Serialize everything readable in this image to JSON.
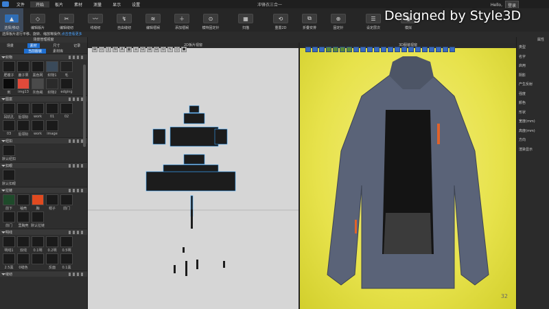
{
  "menubar": {
    "items": [
      "文件",
      "开始",
      "板片",
      "素材",
      "测量",
      "显示",
      "设置"
    ],
    "title": "冲锋衣三合一",
    "user": "Hello,",
    "login": "登录"
  },
  "brand": "Designed by Style3D",
  "toolbar": [
    {
      "label": "选择/移动",
      "icon": "▲"
    },
    {
      "label": "编辑版片",
      "icon": "◇"
    },
    {
      "label": "编辑缝纫",
      "icon": "✂"
    },
    {
      "label": "线缝纫",
      "icon": "〰"
    },
    {
      "label": "自由缝纫",
      "icon": "↯"
    },
    {
      "label": "编辑褶裥",
      "icon": "≋"
    },
    {
      "label": "添加褶裥",
      "icon": "＋"
    },
    {
      "label": "模特固定针",
      "icon": "⊙"
    },
    {
      "label": "扫描",
      "icon": "▦"
    },
    {
      "label": "重置2D",
      "icon": "⟲"
    },
    {
      "label": "折叠安排",
      "icon": "⧉"
    },
    {
      "label": "固定针",
      "icon": "⊕"
    },
    {
      "label": "设定层次",
      "icon": "☰"
    },
    {
      "label": "模拟",
      "icon": "◉"
    }
  ],
  "hint": {
    "text": "选择板片进行平移、旋转、缩放等操作",
    "link": "点击查看更多"
  },
  "left": {
    "title": "场景管理视窗",
    "tabs": [
      "场景",
      "素材",
      "尺寸",
      "记录"
    ],
    "subtabs": [
      "当前服装",
      "素材库"
    ],
    "sections": [
      {
        "name": "织物",
        "items": [
          "肥瘦子",
          "鹿子果",
          "黑色网",
          "织物1",
          "毛",
          "刺",
          "img13",
          "灰色绳",
          "织物2",
          "edging"
        ]
      },
      {
        "name": "图案",
        "items": [
          "耳机孔",
          "后领标",
          "work",
          "01",
          "02",
          "03",
          "后领标",
          "work",
          "image"
        ]
      },
      {
        "name": "纽扣",
        "items": [
          "默认纽扣"
        ]
      },
      {
        "name": "扣眼",
        "items": [
          "默认扣眼"
        ]
      },
      {
        "name": "拉链",
        "items": [
          "前下",
          "袖壳",
          "胸",
          "帽子",
          "前门",
          "前门",
          "里胸壳",
          "默认拉链"
        ]
      },
      {
        "name": "明线",
        "items": [
          "明线1",
          "双线",
          "0.1明",
          "0.2明",
          "0.5明",
          "2.5黑",
          "0缝色",
          "",
          "反面",
          "0.1黑"
        ]
      },
      {
        "name": "缝纫",
        "items": []
      }
    ]
  },
  "view2d": {
    "title": "2D板片视窗",
    "tools": [
      "⊞",
      "▭",
      "▯",
      "N",
      "A",
      "▦",
      "⌂",
      "⊡",
      "⊞",
      "⊟",
      "⊙",
      "✎",
      "⬡",
      "⬢"
    ]
  },
  "view3d": {
    "title": "3D服装视窗",
    "counter": "32"
  },
  "right": {
    "title": "属性",
    "props": [
      "类型",
      "名字",
      "启用",
      "阴影",
      "产生反射",
      "强度",
      "颜色",
      "形状",
      "宽度(mm)",
      "高度(mm)",
      "方向",
      "渲染显示"
    ]
  }
}
